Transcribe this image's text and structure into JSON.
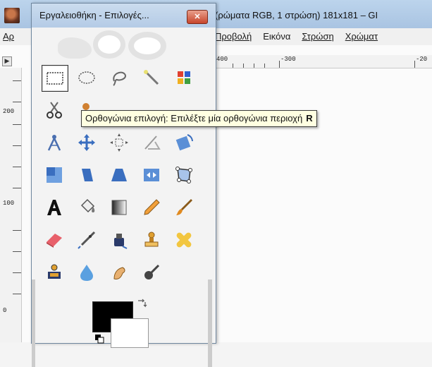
{
  "background_window": {
    "title": "(ρώματα RGB, 1 στρώση) 181x181 – GI",
    "menu_left": "Αρ",
    "menu_items": [
      {
        "label": "Προβολή",
        "underlined": true
      },
      {
        "label": "Εικόνα",
        "underlined": false
      },
      {
        "label": "Στρώση",
        "underlined": true
      },
      {
        "label": "Χρώματ",
        "underlined": true
      }
    ],
    "ruler_h_labels": [
      "400",
      "-300",
      "-20"
    ],
    "ruler_v_labels": [
      "200",
      "100",
      "0"
    ]
  },
  "toolbox": {
    "title": "Εργαλειοθήκη - Επιλογές...",
    "close_label": "✕",
    "tools": [
      {
        "name": "rect-select",
        "icon": "rect-select-icon"
      },
      {
        "name": "ellipse-select",
        "icon": "ellipse-select-icon"
      },
      {
        "name": "free-select",
        "icon": "lasso-icon"
      },
      {
        "name": "fuzzy-select",
        "icon": "magic-wand-icon"
      },
      {
        "name": "select-by-color",
        "icon": "color-select-icon"
      },
      {
        "name": "scissors-select",
        "icon": "scissors-icon"
      },
      {
        "name": "foreground-select",
        "icon": "foreground-select-icon"
      },
      {
        "name": "paths",
        "icon": "paths-icon"
      },
      {
        "name": "color-picker",
        "icon": "color-picker-icon"
      },
      {
        "name": "zoom",
        "icon": "zoom-icon"
      },
      {
        "name": "measure",
        "icon": "compass-icon"
      },
      {
        "name": "move",
        "icon": "move-icon"
      },
      {
        "name": "align",
        "icon": "align-icon"
      },
      {
        "name": "crop",
        "icon": "crop-icon"
      },
      {
        "name": "rotate",
        "icon": "rotate-icon"
      },
      {
        "name": "scale",
        "icon": "scale-icon"
      },
      {
        "name": "shear",
        "icon": "shear-icon"
      },
      {
        "name": "perspective",
        "icon": "perspective-icon"
      },
      {
        "name": "flip",
        "icon": "flip-icon"
      },
      {
        "name": "cage-transform",
        "icon": "cage-icon"
      },
      {
        "name": "text",
        "icon": "text-icon"
      },
      {
        "name": "bucket-fill",
        "icon": "bucket-icon"
      },
      {
        "name": "blend",
        "icon": "gradient-icon"
      },
      {
        "name": "pencil",
        "icon": "pencil-icon"
      },
      {
        "name": "paintbrush",
        "icon": "paintbrush-icon"
      },
      {
        "name": "eraser",
        "icon": "eraser-icon"
      },
      {
        "name": "airbrush",
        "icon": "airbrush-icon"
      },
      {
        "name": "ink",
        "icon": "ink-icon"
      },
      {
        "name": "clone",
        "icon": "clone-stamp-icon"
      },
      {
        "name": "heal",
        "icon": "heal-icon"
      },
      {
        "name": "perspective-clone",
        "icon": "perspective-clone-icon"
      },
      {
        "name": "blur-sharpen",
        "icon": "drop-icon"
      },
      {
        "name": "smudge",
        "icon": "smudge-icon"
      },
      {
        "name": "dodge-burn",
        "icon": "dodge-burn-icon"
      }
    ],
    "fg_color": "#000000",
    "bg_color": "#ffffff"
  },
  "tooltip": {
    "text": "Ορθογώνια επιλογή: Επιλέξτε μία ορθογώνια περιοχή",
    "shortcut": "R"
  }
}
